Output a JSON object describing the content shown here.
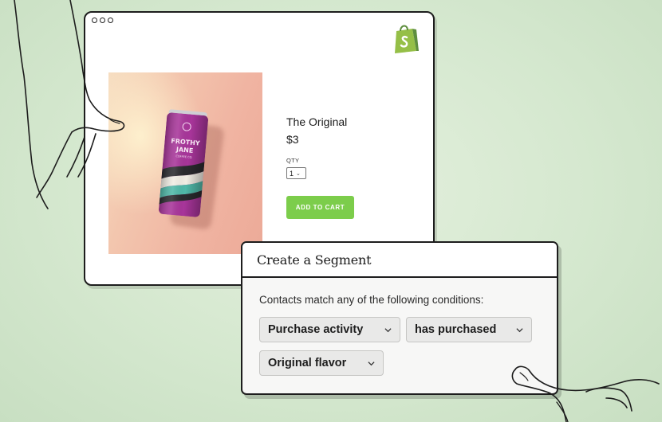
{
  "store": {
    "product": {
      "title": "The Original",
      "price": "$3",
      "qty_label": "QTY",
      "qty_value": "1",
      "add_to_cart_label": "ADD TO CART",
      "can_brand": "FROTHY JANE",
      "can_subtitle": "COFFEE CO."
    },
    "logo_icon": "shopping-bag-icon",
    "accent_color": "#7ccd4b"
  },
  "segment": {
    "title": "Create a Segment",
    "conditions_text": "Contacts match any of the following conditions:",
    "conditions": [
      {
        "label": "Purchase activity",
        "icon": "chevron-down-icon"
      },
      {
        "label": "has purchased",
        "icon": "chevron-down-icon"
      },
      {
        "label": "Original flavor",
        "icon": "chevron-down-icon"
      }
    ]
  },
  "colors": {
    "background": "#d5e8cf",
    "can_purple": "#a8359a",
    "can_teal": "#4fb8a8"
  }
}
